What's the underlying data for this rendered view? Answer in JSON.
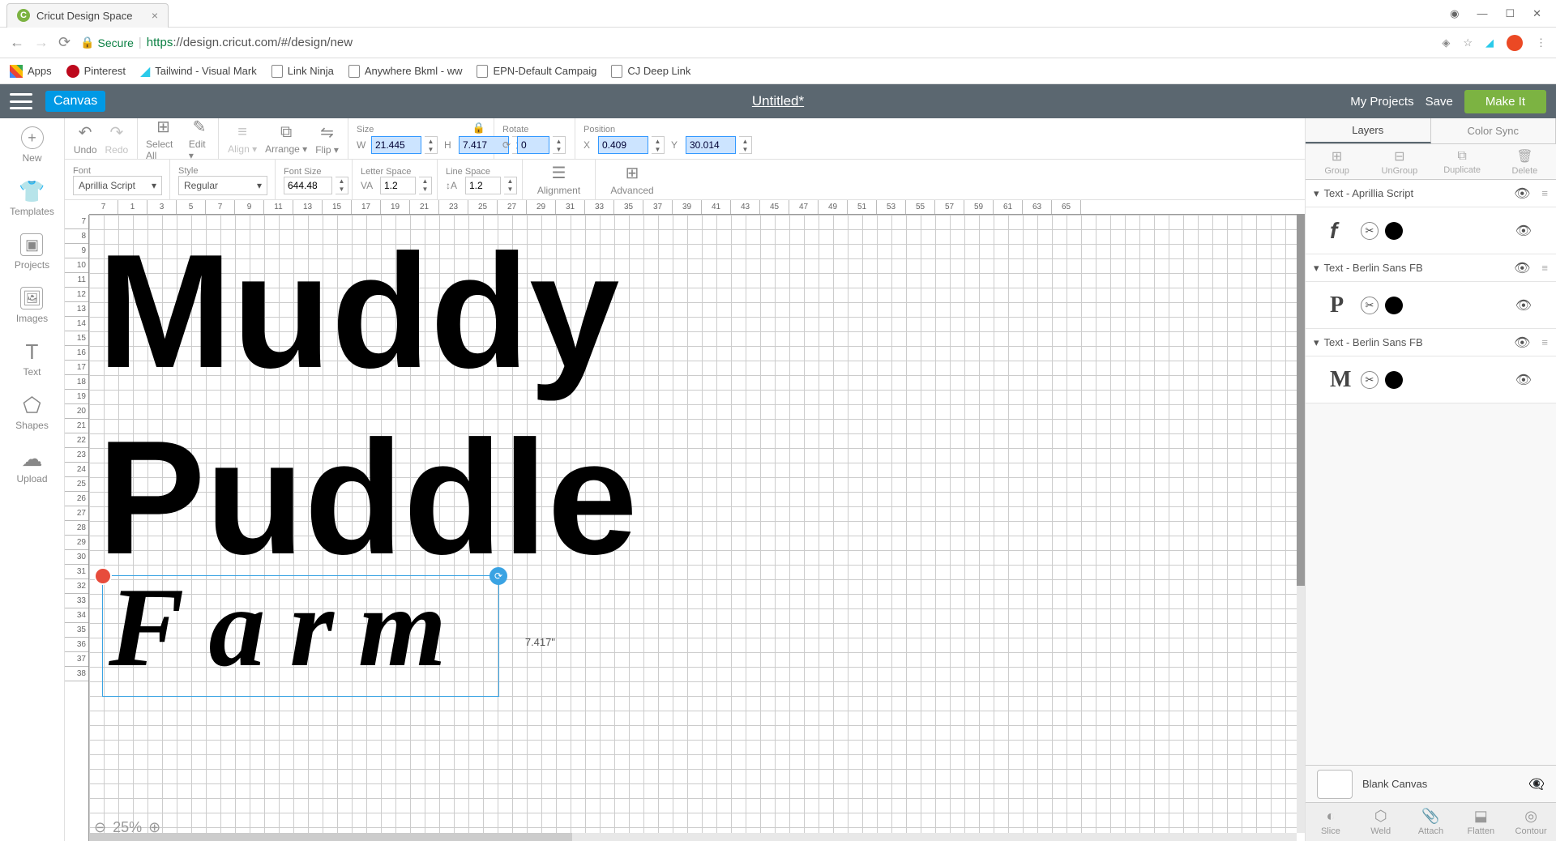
{
  "browser": {
    "tab_title": "Cricut Design Space",
    "url_https": "https",
    "url_rest": "://design.cricut.com/#/design/new",
    "secure": "Secure",
    "bookmarks": [
      "Apps",
      "Pinterest",
      "Tailwind - Visual Mark",
      "Link Ninja",
      "Anywhere Bkml - ww",
      "EPN-Default Campaig",
      "CJ Deep Link"
    ]
  },
  "header": {
    "canvas": "Canvas",
    "title": "Untitled*",
    "my_projects": "My Projects",
    "save": "Save",
    "make_it": "Make It"
  },
  "left_tools": [
    "New",
    "Templates",
    "Projects",
    "Images",
    "Text",
    "Shapes",
    "Upload"
  ],
  "ribbon": {
    "r1": {
      "undo": "Undo",
      "redo": "Redo",
      "select_all": "Select All",
      "edit": "Edit",
      "align": "Align",
      "arrange": "Arrange",
      "flip": "Flip",
      "size": "Size",
      "w": "21.445",
      "h": "7.417",
      "rotate": "Rotate",
      "rot": "0",
      "position": "Position",
      "x": "0.409",
      "y": "30.014"
    },
    "r2": {
      "font": "Font",
      "font_val": "Aprillia Script",
      "style": "Style",
      "style_val": "Regular",
      "font_size": "Font Size",
      "fs_val": "644.48",
      "letter_space": "Letter Space",
      "ls_val": "1.2",
      "line_space": "Line Space",
      "lns_val": "1.2",
      "alignment": "Alignment",
      "advanced": "Advanced"
    }
  },
  "canvas": {
    "text1": "Muddy",
    "text2": "Puddle",
    "text3": "Farm",
    "sel_dim": "7.417\"",
    "zoom": "25%"
  },
  "rulers": {
    "h": [
      "7",
      "1",
      "3",
      "5",
      "7",
      "9",
      "11",
      "13",
      "15",
      "17",
      "19",
      "21",
      "23",
      "25",
      "27",
      "29",
      "31",
      "33",
      "35",
      "37",
      "39",
      "41",
      "43",
      "45",
      "47",
      "49",
      "51",
      "53",
      "55",
      "57",
      "59",
      "61",
      "63",
      "65"
    ],
    "v": [
      "7",
      "8",
      "9",
      "10",
      "11",
      "12",
      "13",
      "14",
      "15",
      "16",
      "17",
      "18",
      "19",
      "20",
      "21",
      "22",
      "23",
      "24",
      "25",
      "26",
      "27",
      "28",
      "29",
      "30",
      "31",
      "32",
      "33",
      "34",
      "35",
      "36",
      "37",
      "38"
    ]
  },
  "right": {
    "tabs": [
      "Layers",
      "Color Sync"
    ],
    "ops": [
      "Group",
      "UnGroup",
      "Duplicate",
      "Delete"
    ],
    "layers": [
      {
        "name": "Text - Aprillia Script",
        "glyph": "f",
        "script": true
      },
      {
        "name": "Text - Berlin Sans FB",
        "glyph": "P",
        "script": false
      },
      {
        "name": "Text - Berlin Sans FB",
        "glyph": "M",
        "script": false
      }
    ],
    "blank": "Blank Canvas",
    "bottom": [
      "Slice",
      "Weld",
      "Attach",
      "Flatten",
      "Contour"
    ]
  }
}
